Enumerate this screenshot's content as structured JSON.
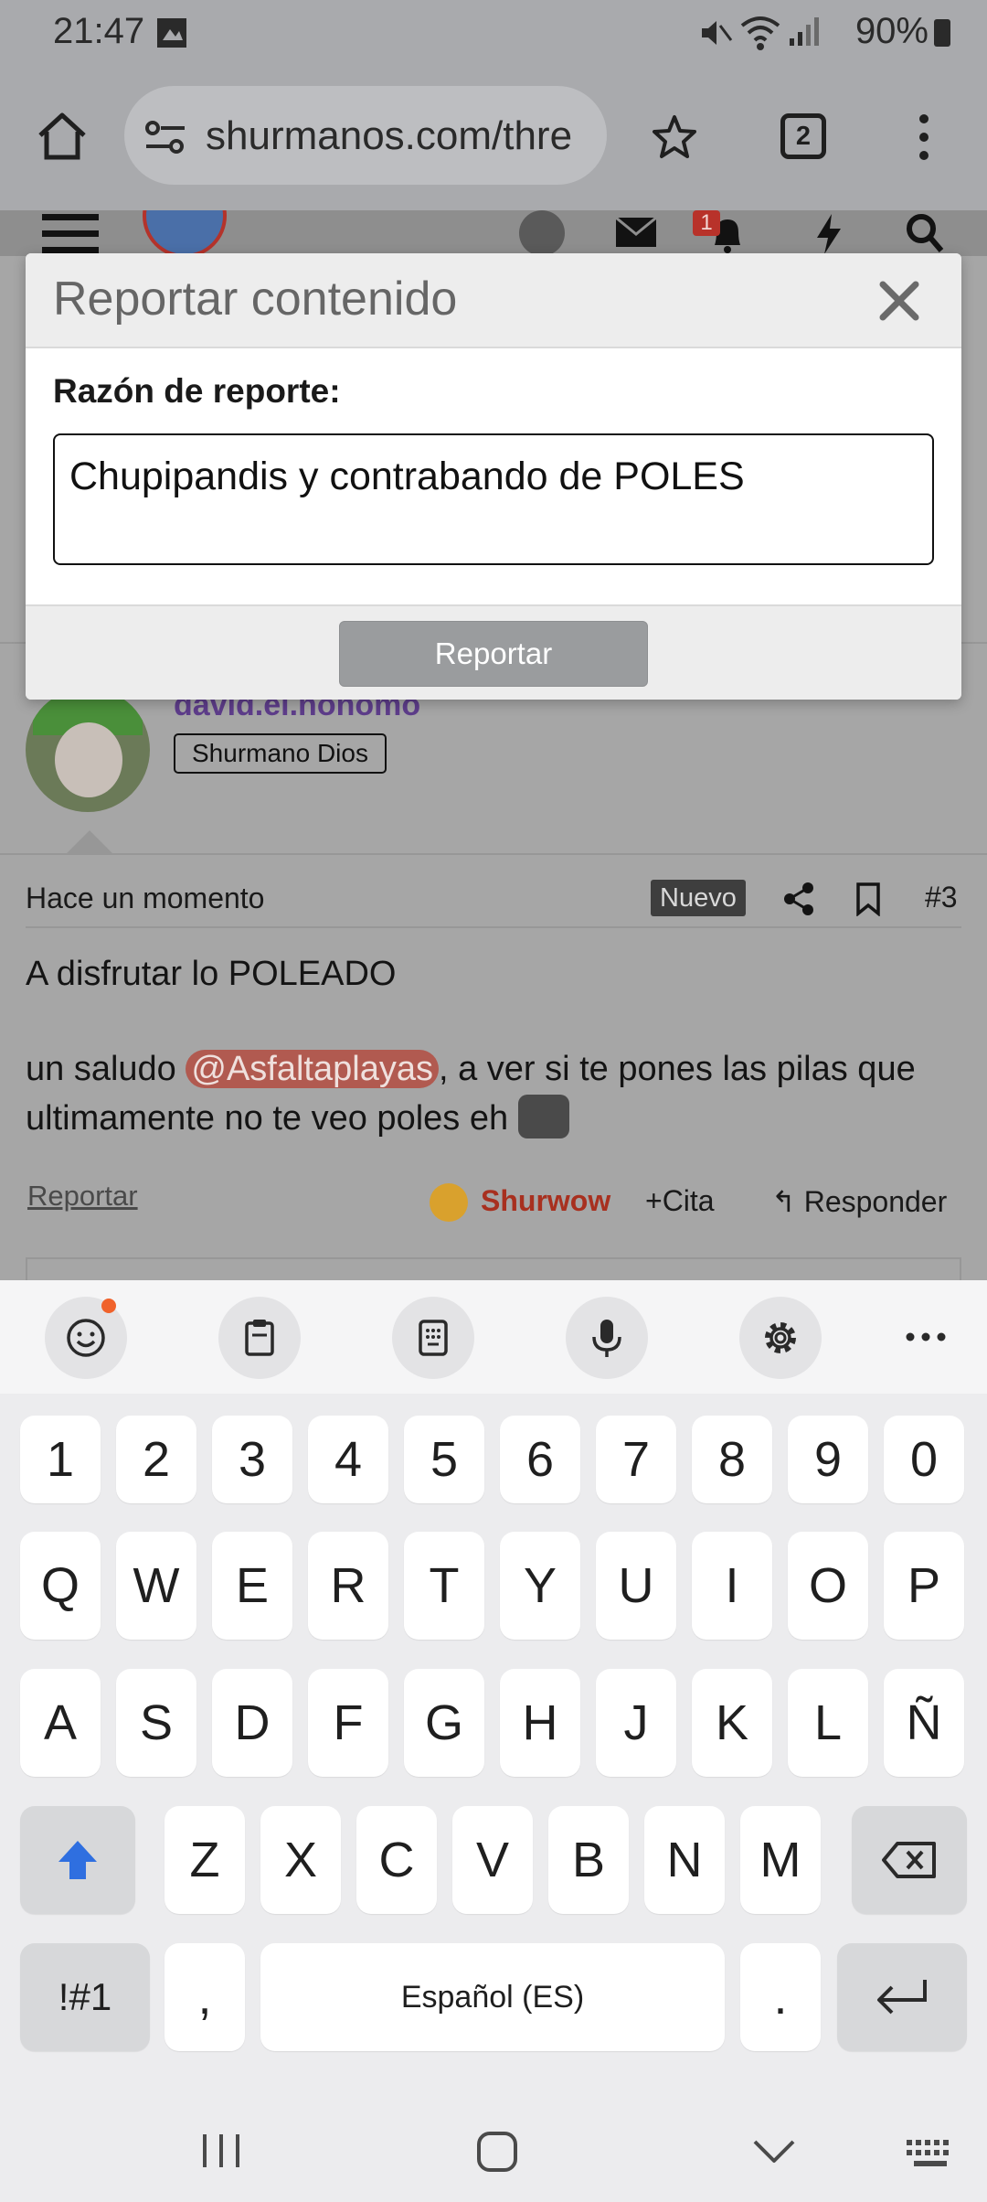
{
  "status_bar": {
    "time": "21:47",
    "battery": "90%"
  },
  "browser": {
    "url": "shurmanos.com/thre",
    "tab_count": "2"
  },
  "site": {
    "notification_count": "1",
    "post": {
      "username": "david.el.nonomo",
      "user_title": "Shurmano Dios",
      "time": "Hace un momento",
      "new_badge": "Nuevo",
      "post_number": "#3",
      "line1": "A disfrutar lo POLEADO",
      "line2_before": "un saludo ",
      "mention": "@Asfaltaplayas",
      "line2_after": ", a ver si te pones las pilas que ultimamente no te veo poles eh",
      "report_link": "Reportar",
      "reaction": "Shurwow",
      "quote": "Cita",
      "reply": "Responder"
    }
  },
  "modal": {
    "title": "Reportar contenido",
    "reason_label": "Razón de reporte:",
    "reason_value": "Chupipandis y contrabando de POLES",
    "submit_label": "Reportar"
  },
  "keyboard": {
    "toolbar_icons": [
      "emoji-icon",
      "clipboard-icon",
      "keypad-icon",
      "microphone-icon",
      "settings-gear-icon",
      "more-options-icon"
    ],
    "row_numbers": [
      "1",
      "2",
      "3",
      "4",
      "5",
      "6",
      "7",
      "8",
      "9",
      "0"
    ],
    "row_top": [
      "Q",
      "W",
      "E",
      "R",
      "T",
      "Y",
      "U",
      "I",
      "O",
      "P"
    ],
    "row_middle": [
      "A",
      "S",
      "D",
      "F",
      "G",
      "H",
      "J",
      "K",
      "L",
      "Ñ"
    ],
    "row_bottom": [
      "Z",
      "X",
      "C",
      "V",
      "B",
      "N",
      "M"
    ],
    "symbols_label": "!#1",
    "comma_label": ",",
    "space_label": "Español (ES)",
    "period_label": "."
  },
  "colors": {
    "mention_bg": "#b15a50",
    "shurwow": "#a8301f",
    "username": "#5e3d8b",
    "shift_arrow": "#2f6fe0"
  }
}
